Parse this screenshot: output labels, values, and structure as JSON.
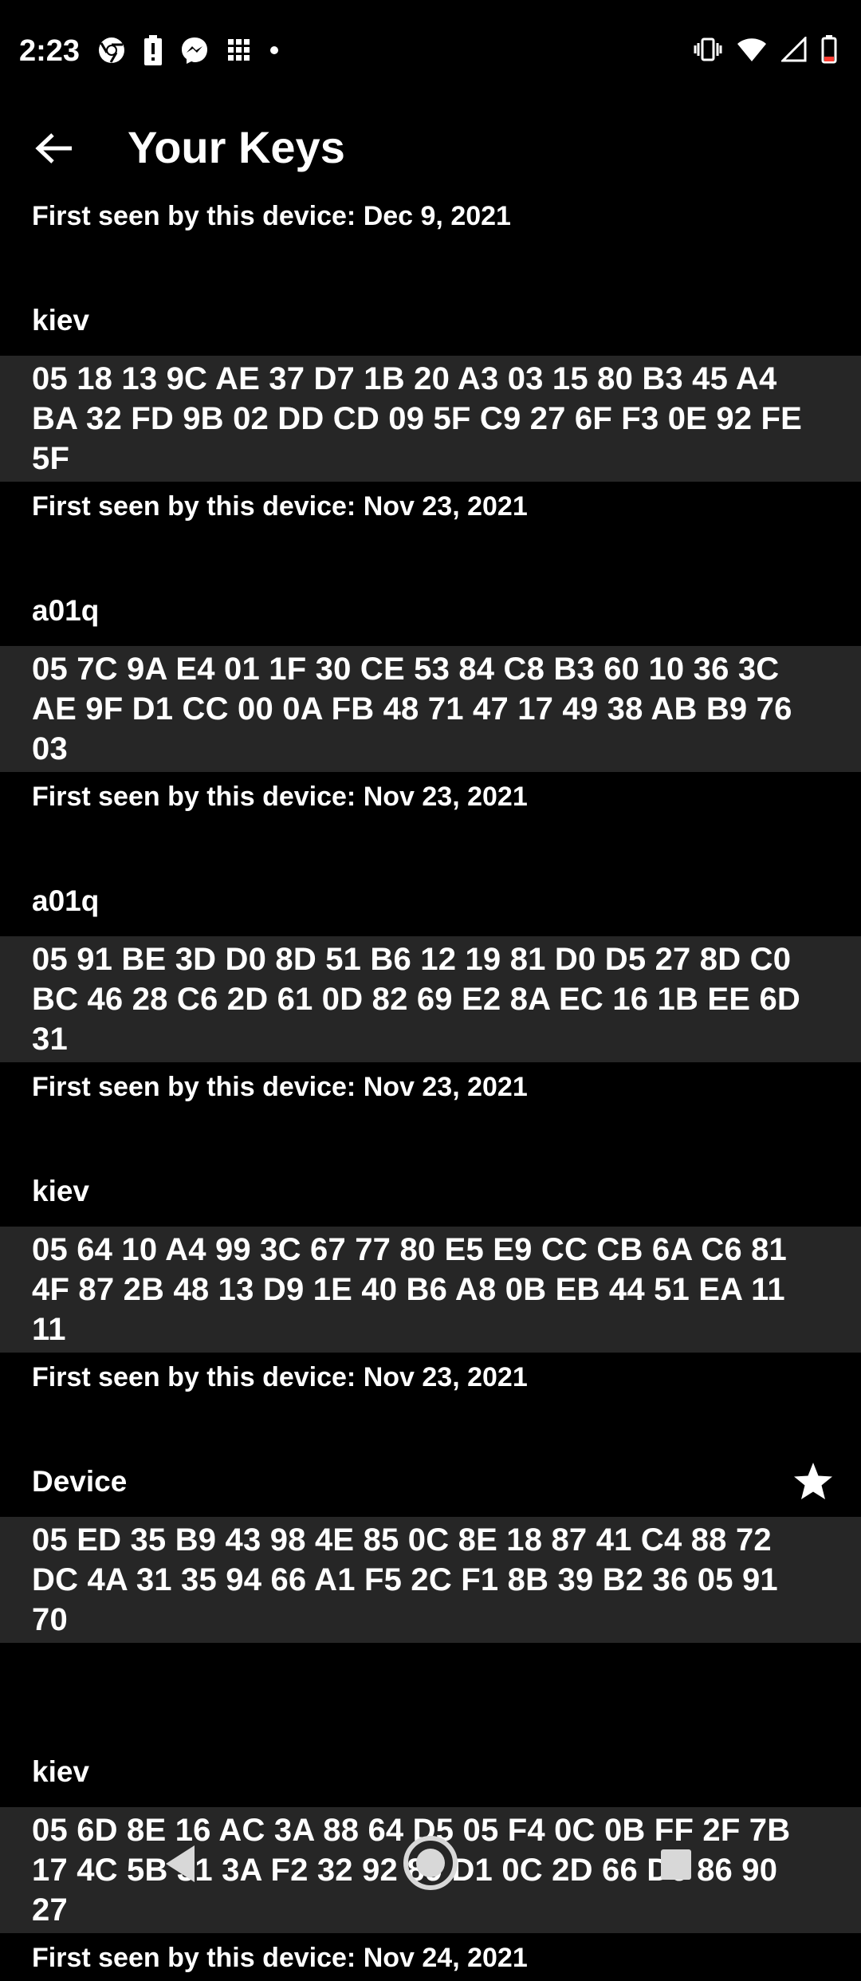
{
  "status_bar": {
    "time": "2:23",
    "left_icons": [
      "chrome-icon",
      "battery-alert-icon",
      "messenger-icon",
      "grid-icon",
      "dot-icon"
    ],
    "right_icons": [
      "vibrate-icon",
      "wifi-icon",
      "signal-icon",
      "battery-low-icon"
    ]
  },
  "app_bar": {
    "title": "Your Keys",
    "back_icon": "arrow-back-icon"
  },
  "keys": {
    "top_seen": "First seen by this device: Dec 9, 2021",
    "items": [
      {
        "name": "kiev",
        "key_lines": [
          "05 18 13 9C AE 37 D7 1B 20 A3 03 15 80 B3 45 A4",
          "BA 32 FD 9B 02 DD CD 09 5F C9 27 6F F3 0E 92 FE",
          "5F"
        ],
        "seen": "First seen by this device: Nov 23, 2021"
      },
      {
        "name": "a01q",
        "key_lines": [
          "05 7C 9A E4 01 1F 30 CE 53 84 C8 B3 60 10 36 3C",
          "AE 9F D1 CC 00 0A FB 48 71 47 17 49 38 AB B9 76",
          "03"
        ],
        "seen": "First seen by this device: Nov 23, 2021"
      },
      {
        "name": "a01q",
        "key_lines": [
          "05 91 BE 3D D0 8D 51 B6 12 19 81 D0 D5 27 8D C0",
          "BC 46 28 C6 2D 61 0D 82 69 E2 8A EC 16 1B EE 6D",
          "31"
        ],
        "seen": "First seen by this device: Nov 23, 2021"
      },
      {
        "name": "kiev",
        "key_lines": [
          "05 64 10 A4 99 3C 67 77 80 E5 E9 CC CB 6A C6 81",
          "4F 87 2B 48 13 D9 1E 40 B6 A8 0B EB 44 51 EA 11",
          "11"
        ],
        "seen": "First seen by this device: Nov 23, 2021"
      },
      {
        "name": "Device",
        "starred": true,
        "key_lines": [
          "05 ED 35 B9 43 98 4E 85 0C 8E 18 87 41 C4 88 72",
          "DC 4A 31 35 94 66 A1 F5 2C F1 8B 39 B2 36 05 91",
          "70"
        ],
        "seen": ""
      },
      {
        "name": "kiev",
        "key_lines": [
          "05 6D 8E 16 AC 3A 88 64 D5 05 F4 0C 0B FF 2F 7B",
          "17 4C 5B 31 3A F2 32 92 89 D1 0C 2D 66 D6 86 90",
          "27"
        ],
        "seen": "First seen by this device: Nov 24, 2021"
      }
    ]
  },
  "nav_bar": {
    "icons": [
      "nav-back-icon",
      "nav-home-icon",
      "nav-recents-icon"
    ]
  },
  "colors": {
    "background": "#000000",
    "key_box": "#262626",
    "text": "#ffffff"
  }
}
